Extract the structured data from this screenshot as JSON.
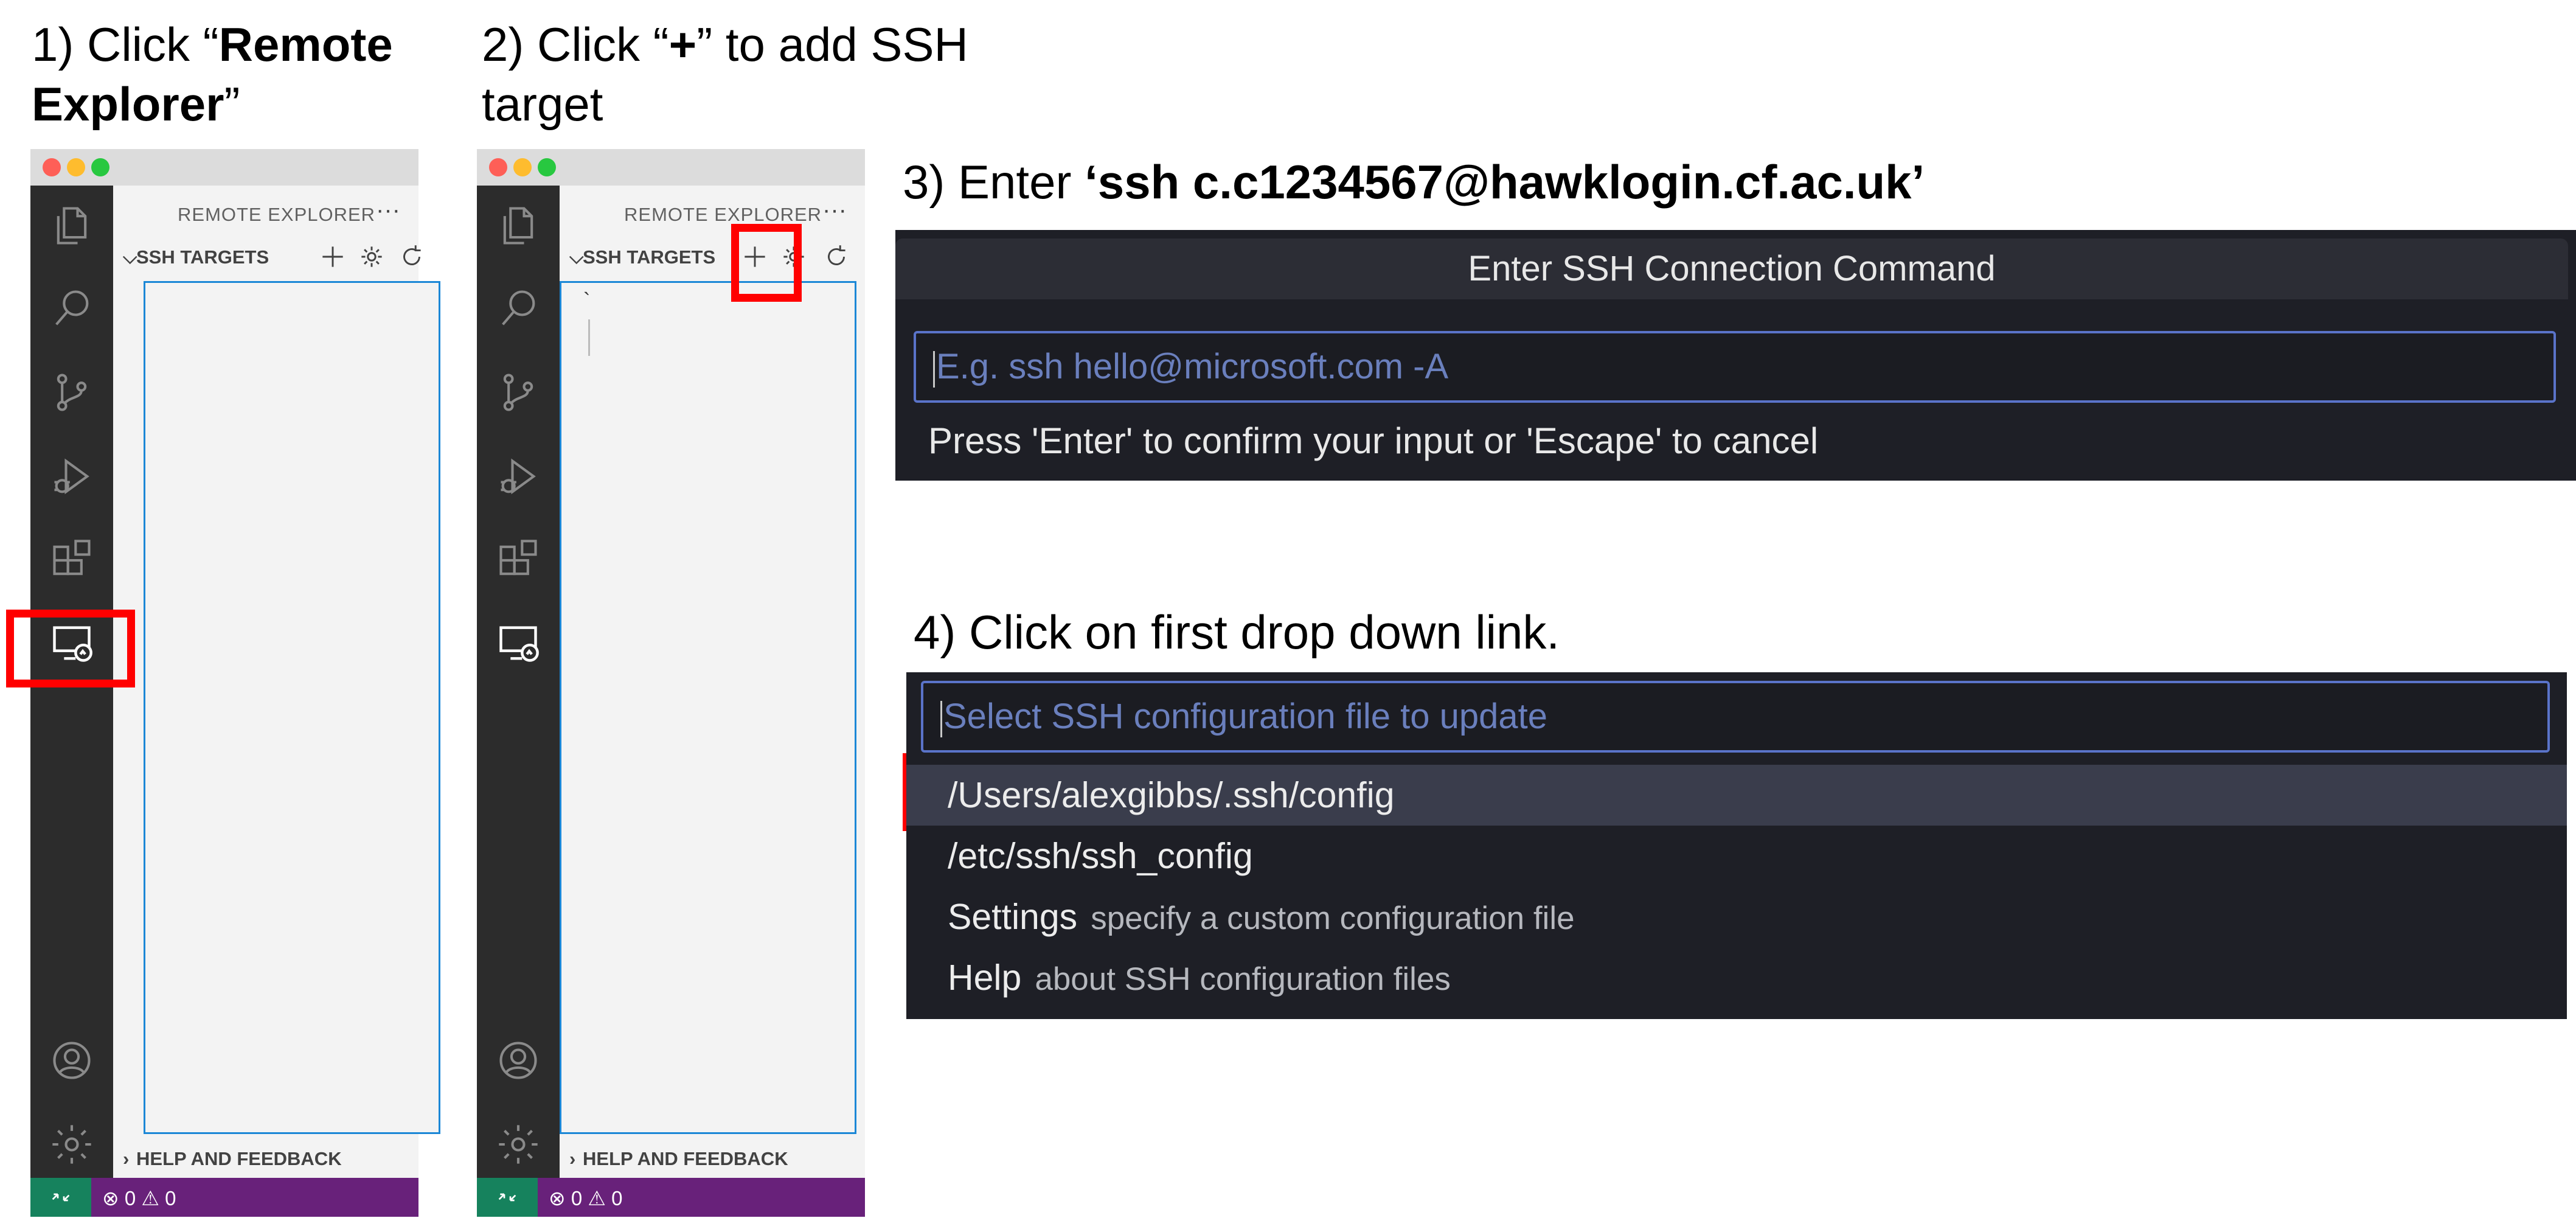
{
  "steps": {
    "s1": {
      "prefix": "1) Click “",
      "bold": "Remote",
      "line2_bold": "Explorer",
      "line2_suffix": "”"
    },
    "s2": {
      "prefix": "2) Click “",
      "bold": "+",
      "suffix": "” to add SSH",
      "line2": "target"
    },
    "s3": {
      "prefix": "3) Enter ",
      "bold": "‘ssh c.c1234567@hawklogin.cf.ac.uk’"
    },
    "s4": {
      "text": "4) Click on first drop down link."
    }
  },
  "vscode": {
    "panel_title": "REMOTE EXPLORER",
    "more_label": "···",
    "section_label": "SSH TARGETS",
    "help_section": "HELP AND FEEDBACK",
    "status_errors": "0",
    "status_warnings": "0",
    "backtick": "`",
    "activity_icons": [
      "explorer-icon",
      "search-icon",
      "source-control-icon",
      "run-debug-icon",
      "extensions-icon",
      "remote-explorer-icon",
      "account-icon",
      "manage-gear-icon"
    ],
    "toolbar_icons": [
      "add-icon",
      "gear-icon",
      "refresh-icon"
    ]
  },
  "ssh_dialog": {
    "title": "Enter SSH Connection Command",
    "placeholder": "E.g. ssh hello@microsoft.com -A",
    "hint": "Press 'Enter' to confirm your input or 'Escape' to cancel"
  },
  "config_dialog": {
    "placeholder": "Select SSH configuration file to update",
    "options": [
      {
        "label": "/Users/alexgibbs/.ssh/config",
        "desc": ""
      },
      {
        "label": "/etc/ssh/ssh_config",
        "desc": ""
      },
      {
        "label": "Settings",
        "desc": "specify a custom configuration file"
      },
      {
        "label": "Help",
        "desc": "about SSH configuration files"
      }
    ]
  },
  "colors": {
    "highlight": "#ff0000",
    "status_bar": "#68217a",
    "remote_button": "#16825d",
    "dialog_bg": "#1e1f26",
    "input_border": "#5a73c9"
  }
}
